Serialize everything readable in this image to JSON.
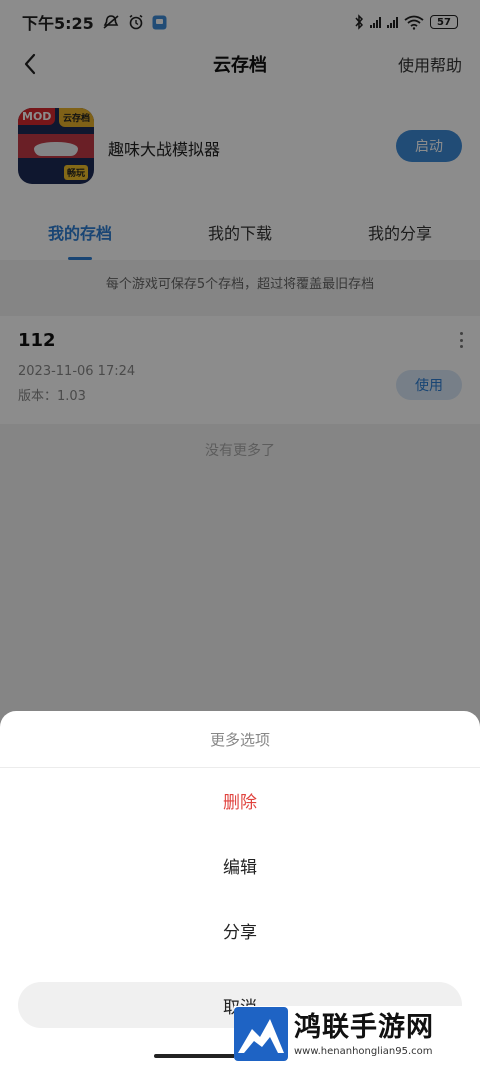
{
  "status_bar": {
    "time": "下午5:25",
    "left_icons": [
      "mute-icon",
      "alarm-icon",
      "app-notification-icon"
    ],
    "right_icons": [
      "bluetooth-icon",
      "signal-icon",
      "signal-icon",
      "wifi-icon"
    ],
    "battery": "57"
  },
  "nav": {
    "back_icon": "chevron-left-icon",
    "title": "云存档",
    "help": "使用帮助"
  },
  "game": {
    "name": "趣味大战模拟器",
    "icon_labels": {
      "mod": "MOD",
      "cloud": "云存档",
      "tag": "畅玩"
    },
    "launch_label": "启动"
  },
  "tabs": [
    {
      "label": "我的存档",
      "active": true
    },
    {
      "label": "我的下载",
      "active": false
    },
    {
      "label": "我的分享",
      "active": false
    }
  ],
  "notice": "每个游戏可保存5个存档，超过将覆盖最旧存档",
  "saves": [
    {
      "name": "112",
      "date": "2023-11-06 17:24",
      "version": "版本：1.03",
      "use_label": "使用"
    }
  ],
  "no_more": "没有更多了",
  "sheet": {
    "title": "更多选项",
    "options": [
      {
        "label": "删除",
        "danger": true
      },
      {
        "label": "编辑",
        "danger": false
      },
      {
        "label": "分享",
        "danger": false
      }
    ],
    "cancel": "取消"
  },
  "watermark": {
    "title": "鸿联手游网",
    "url": "www.henanhonglian95.com"
  },
  "colors": {
    "accent": "#2e7fd3",
    "launch_button": "#3c8ad8",
    "danger": "#e0433e",
    "overlay": "rgba(0,0,0,0.45)"
  }
}
